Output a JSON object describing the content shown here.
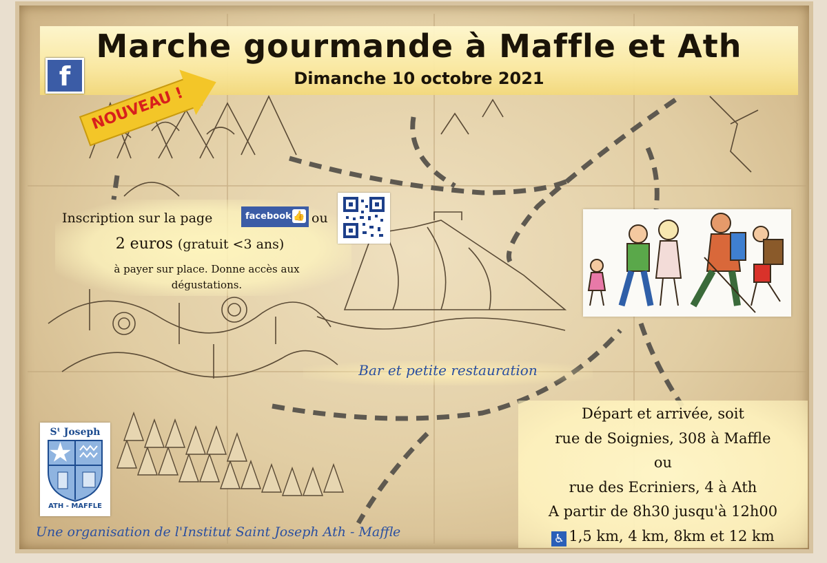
{
  "header": {
    "title": "Marche gourmande à Maffle et Ath",
    "date": "Dimanche 10 octobre 2021"
  },
  "social": {
    "facebook_icon": "f"
  },
  "badge": {
    "label": "NOUVEAU !",
    "color": "#f3c628",
    "text_color": "#d8201c"
  },
  "registration": {
    "line_prefix": "Inscription sur la page",
    "facebook_label": "facebook",
    "line_suffix": "ou",
    "price": "2 euros",
    "price_note": "(gratuit <3 ans)",
    "details": "à payer sur place. Donne accès aux dégustations."
  },
  "bar": {
    "text": "Bar et petite restauration"
  },
  "departure": {
    "line1": "Départ et arrivée, soit",
    "line2": "rue de Soignies, 308 à Maffle",
    "line3": "ou",
    "line4": "rue des Ecriniers, 4 à Ath",
    "line5": "A partir de 8h30 jusqu'à 12h00",
    "distances": "1,5 km, 4 km, 8km et 12 km",
    "accessibility_icon": "wheelchair-icon"
  },
  "school": {
    "name": "Sᵗ Joseph",
    "location": "ATH - MAFFLE"
  },
  "footer": {
    "organizer": "Une organisation de l'Institut Saint Joseph Ath - Maffle"
  },
  "colors": {
    "banner": "#fbeaa3",
    "facebook": "#3b5ca6",
    "link_blue": "#2a4fa0",
    "parchment": "#e1cda3"
  }
}
